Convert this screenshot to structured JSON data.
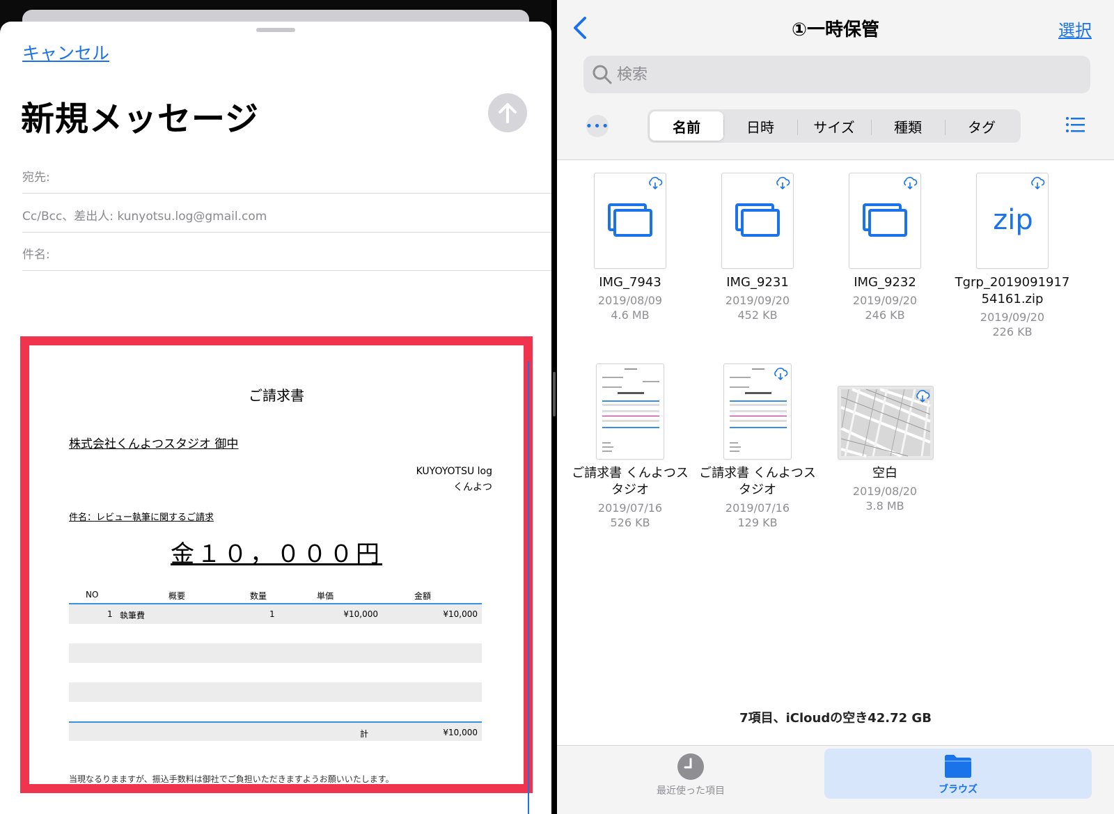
{
  "mail": {
    "cancel_label": "キャンセル",
    "title": "新規メッセージ",
    "to_label": "宛先:",
    "cc_label": "Cc/Bcc、差出人:",
    "cc_value": "kunyotsu.log@gmail.com",
    "subject_label": "件名:"
  },
  "invoice": {
    "title": "ご請求書",
    "recipient": "株式会社くんよつスタジオ 御中",
    "sender_line1": "KUYOYOTSU log",
    "sender_line2": "くんよつ",
    "subject": "件名：レビュー執筆に関するご請求",
    "amount": "金１０，０００円",
    "headers": {
      "no": "NO",
      "desc": "概要",
      "qty": "数量",
      "unit": "単価",
      "total": "金額"
    },
    "rows": [
      {
        "no": "1",
        "desc": "執筆費",
        "qty": "1",
        "unit": "¥10,000",
        "total": "¥10,000"
      }
    ],
    "sum_label": "計",
    "sum_value": "¥10,000",
    "note": "当現なるりまますが、振込手数料は御社でご負担いただきますようお願いいたします。"
  },
  "files": {
    "title": "①一時保管",
    "select_label": "選択",
    "search_placeholder": "検索",
    "sort_tabs": [
      "名前",
      "日時",
      "サイズ",
      "種類",
      "タグ"
    ],
    "active_sort": "名前",
    "items": [
      {
        "name": "IMG_7943",
        "date": "2019/08/09",
        "size": "4.6 MB",
        "kind": "image-stack"
      },
      {
        "name": "IMG_9231",
        "date": "2019/09/20",
        "size": "452 KB",
        "kind": "image-stack"
      },
      {
        "name": "IMG_9232",
        "date": "2019/09/20",
        "size": "246 KB",
        "kind": "image-stack"
      },
      {
        "name": "Tgrp_2019091917 54161.zip",
        "name_line1": "Tgrp_2019091917",
        "name_line2": "54161.zip",
        "date": "2019/09/20",
        "size": "226 KB",
        "kind": "zip",
        "zip_label": "zip"
      },
      {
        "name": "ご請求書 くんよつスタジオ",
        "name_line1": "ご請求書 くんよつス",
        "name_line2": "タジオ",
        "date": "2019/07/16",
        "size": "526 KB",
        "kind": "document"
      },
      {
        "name": "ご請求書 くんよつスタジオ",
        "name_line1": "ご請求書 くんよつス",
        "name_line2": "タジオ",
        "date": "2019/07/16",
        "size": "129 KB",
        "kind": "document"
      },
      {
        "name": "空白",
        "date": "2019/08/20",
        "size": "3.8 MB",
        "kind": "map-image"
      }
    ],
    "footer": "7項目、iCloudの空き42.72 GB",
    "tabs": {
      "recents": "最近使った項目",
      "browse": "ブラウズ"
    }
  },
  "colors": {
    "accent": "#1a73e8",
    "highlight_frame": "#f0344d",
    "table_rule": "#3b8fe0"
  }
}
